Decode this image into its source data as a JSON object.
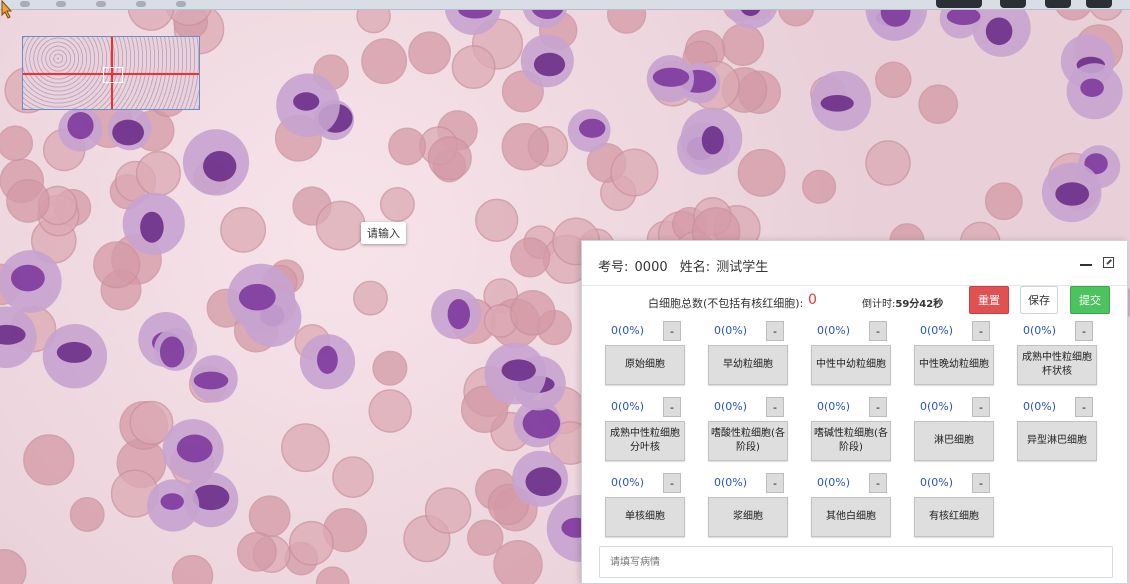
{
  "student": {
    "exam_label": "考号:",
    "exam_no": "0000",
    "name_label": "姓名:",
    "name": "测试学生"
  },
  "summary": {
    "wbc_label": "白细胞总数(不包括有核红细胞):",
    "wbc_count": "0",
    "timer_label": "倒计时:",
    "timer_value": "59分42秒"
  },
  "actions": {
    "reset": "重置",
    "save": "保存",
    "submit": "提交"
  },
  "tooltip": "请输入",
  "cells": [
    {
      "pct": "0(0%)",
      "minus": "-",
      "name": "原始细胞"
    },
    {
      "pct": "0(0%)",
      "minus": "-",
      "name": "早幼粒细胞"
    },
    {
      "pct": "0(0%)",
      "minus": "-",
      "name": "中性中幼粒细胞"
    },
    {
      "pct": "0(0%)",
      "minus": "-",
      "name": "中性晚幼粒细胞"
    },
    {
      "pct": "0(0%)",
      "minus": "-",
      "name": "成熟中性粒细胞杆状核"
    },
    {
      "pct": "0(0%)",
      "minus": "-",
      "name": "成熟中性粒细胞分叶核"
    },
    {
      "pct": "0(0%)",
      "minus": "-",
      "name": "嗜酸性粒细胞(各阶段)"
    },
    {
      "pct": "0(0%)",
      "minus": "-",
      "name": "嗜碱性粒细胞(各阶段)"
    },
    {
      "pct": "0(0%)",
      "minus": "-",
      "name": "淋巴细胞"
    },
    {
      "pct": "0(0%)",
      "minus": "-",
      "name": "异型淋巴细胞"
    },
    {
      "pct": "0(0%)",
      "minus": "-",
      "name": "单核细胞"
    },
    {
      "pct": "0(0%)",
      "minus": "-",
      "name": "浆细胞"
    },
    {
      "pct": "0(0%)",
      "minus": "-",
      "name": "其他白细胞"
    },
    {
      "pct": "0(0%)",
      "minus": "-",
      "name": "有核红细胞"
    }
  ],
  "remark": {
    "placeholder": "请填写病情"
  },
  "colors": {
    "reset": "#e05252",
    "submit": "#4cc35e",
    "count_red": "#e53935",
    "pct_blue": "#2b53c9"
  }
}
